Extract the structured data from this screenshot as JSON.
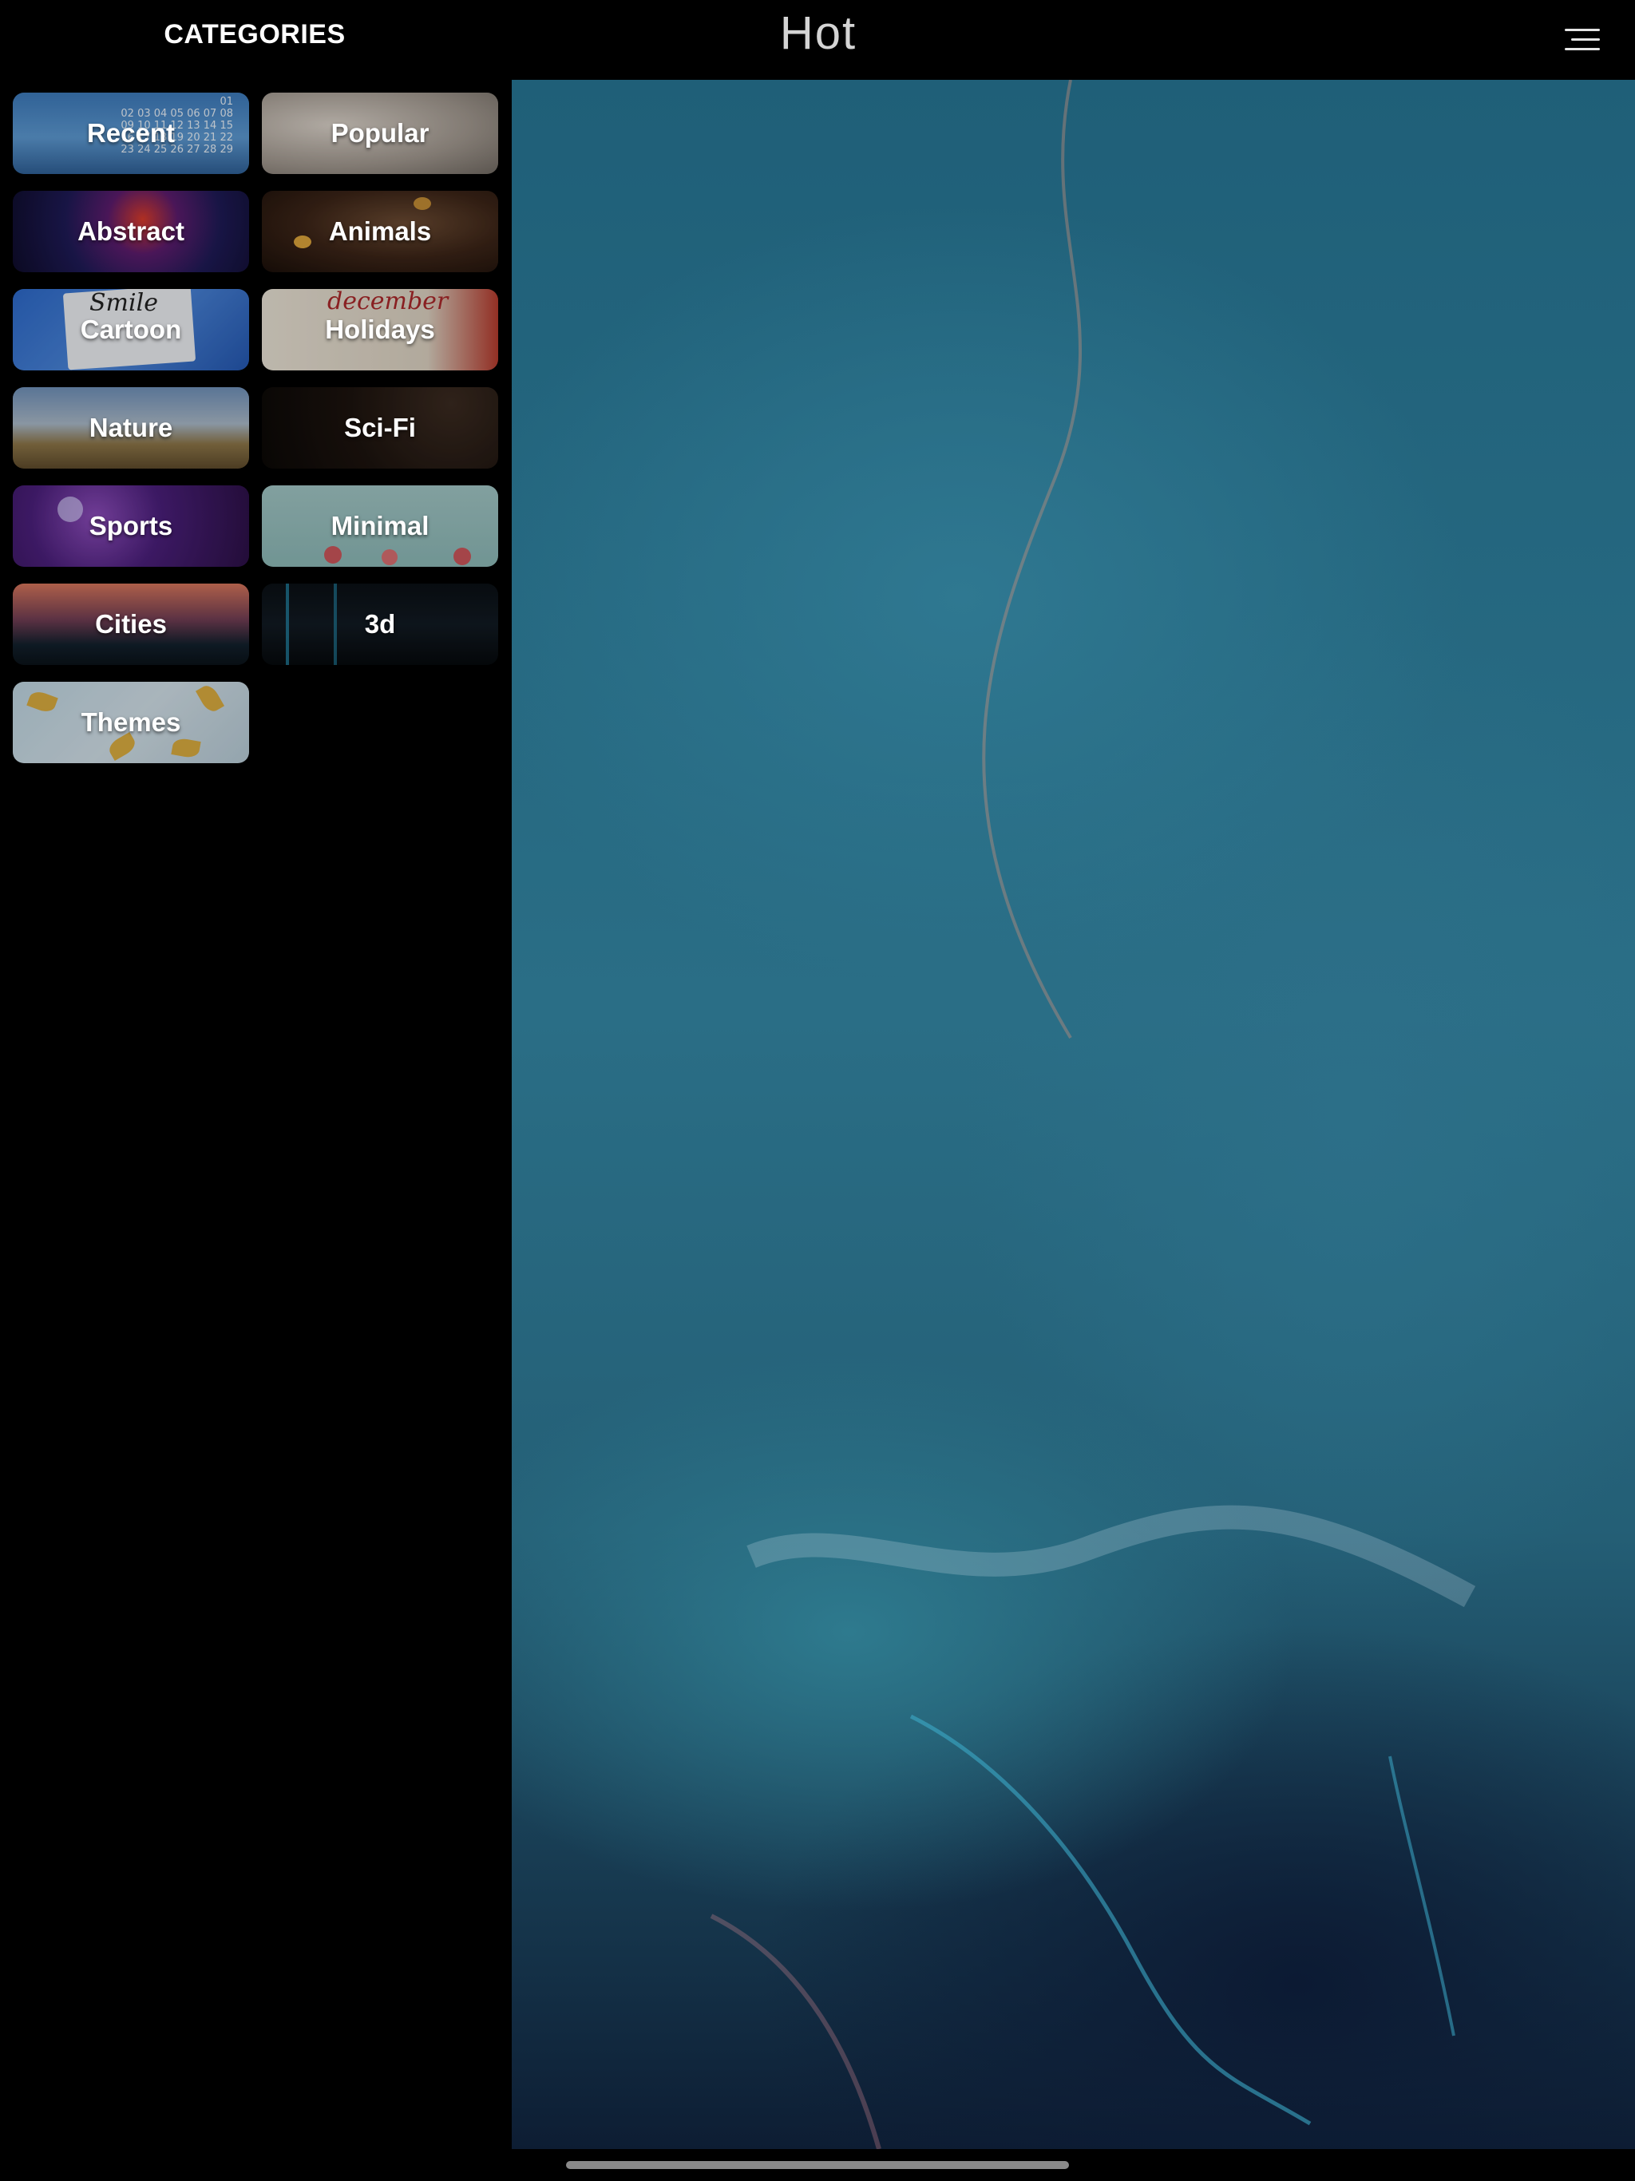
{
  "header": {
    "categories_title": "CATEGORIES",
    "page_title": "Hot",
    "menu_icon": "hamburger-menu-icon"
  },
  "categories": [
    {
      "label": "Recent",
      "theme": "calendar-sky"
    },
    {
      "label": "Popular",
      "theme": "blurred-snowflake"
    },
    {
      "label": "Abstract",
      "theme": "colorful-paint"
    },
    {
      "label": "Animals",
      "theme": "dog-eyes"
    },
    {
      "label": "Cartoon",
      "theme": "smile-sign"
    },
    {
      "label": "Holidays",
      "theme": "december-calendar"
    },
    {
      "label": "Nature",
      "theme": "mountain-landscape"
    },
    {
      "label": "Sci-Fi",
      "theme": "dark-planet"
    },
    {
      "label": "Sports",
      "theme": "space-astronaut"
    },
    {
      "label": "Minimal",
      "theme": "hanging-ornaments"
    },
    {
      "label": "Cities",
      "theme": "sunset-skyline"
    },
    {
      "label": "3d",
      "theme": "neon-cubes"
    },
    {
      "label": "Themes",
      "theme": "autumn-leaves"
    }
  ],
  "decor": {
    "recent_calendar": [
      "01",
      "02 03 04 05 06 07 08",
      "09 10 11 12 13 14 15",
      "16 17 18 19 20 21 22",
      "23 24 25 26 27 28 29"
    ],
    "cartoon_sign": "Smile",
    "holidays_script": "december"
  },
  "colors": {
    "background": "#000000",
    "wallpaper_primary": "#2a6e86",
    "wallpaper_dark": "#0d1d33"
  }
}
